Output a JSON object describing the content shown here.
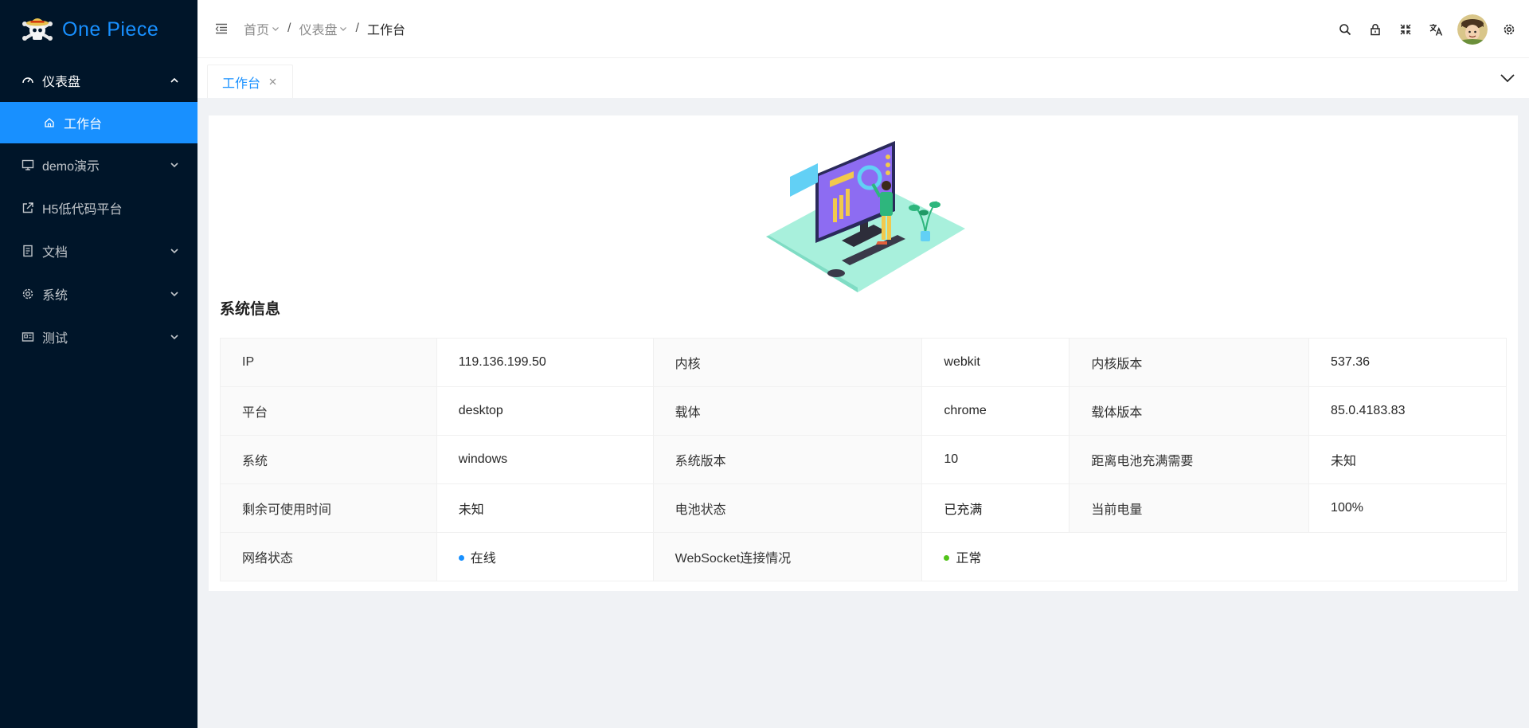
{
  "app": {
    "name": "One Piece"
  },
  "sidebar": {
    "items": [
      {
        "label": "仪表盘",
        "icon": "dashboard-icon",
        "expanded": true,
        "children": [
          {
            "label": "工作台",
            "icon": "home-icon",
            "active": true
          }
        ]
      },
      {
        "label": "demo演示",
        "icon": "desktop-icon",
        "expanded": false
      },
      {
        "label": "H5低代码平台",
        "icon": "external-link-icon",
        "expanded": false
      },
      {
        "label": "文档",
        "icon": "document-icon",
        "expanded": false
      },
      {
        "label": "系统",
        "icon": "settings-icon",
        "expanded": false
      },
      {
        "label": "测试",
        "icon": "id-card-icon",
        "expanded": false
      }
    ]
  },
  "header": {
    "breadcrumb": [
      {
        "label": "首页",
        "has_dropdown": true
      },
      {
        "label": "仪表盘",
        "has_dropdown": true
      },
      {
        "label": "工作台",
        "has_dropdown": false
      }
    ],
    "separator": "/",
    "actions": [
      "search-icon",
      "lock-icon",
      "fullscreen-icon",
      "translate-icon",
      "avatar",
      "settings-icon"
    ]
  },
  "tabs": [
    {
      "label": "工作台",
      "active": true,
      "closable": true
    }
  ],
  "main": {
    "section_title": "系统信息",
    "rows": [
      [
        {
          "label": "IP",
          "value": "119.136.199.50"
        },
        {
          "label": "内核",
          "value": "webkit"
        },
        {
          "label": "内核版本",
          "value": "537.36"
        }
      ],
      [
        {
          "label": "平台",
          "value": "desktop"
        },
        {
          "label": "载体",
          "value": "chrome"
        },
        {
          "label": "载体版本",
          "value": "85.0.4183.83"
        }
      ],
      [
        {
          "label": "系统",
          "value": "windows"
        },
        {
          "label": "系统版本",
          "value": "10"
        },
        {
          "label": "距离电池充满需要",
          "value": "未知"
        }
      ],
      [
        {
          "label": "剩余可使用时间",
          "value": "未知"
        },
        {
          "label": "电池状态",
          "value": "已充满"
        },
        {
          "label": "当前电量",
          "value": "100%"
        }
      ]
    ],
    "status_row": {
      "network_label": "网络状态",
      "network_value": "在线",
      "network_color": "#1890ff",
      "ws_label": "WebSocket连接情况",
      "ws_value": "正常",
      "ws_color": "#52c41a"
    }
  },
  "colors": {
    "sidebar_bg": "#001529",
    "accent": "#1890ff",
    "content_bg": "#f0f2f5"
  }
}
